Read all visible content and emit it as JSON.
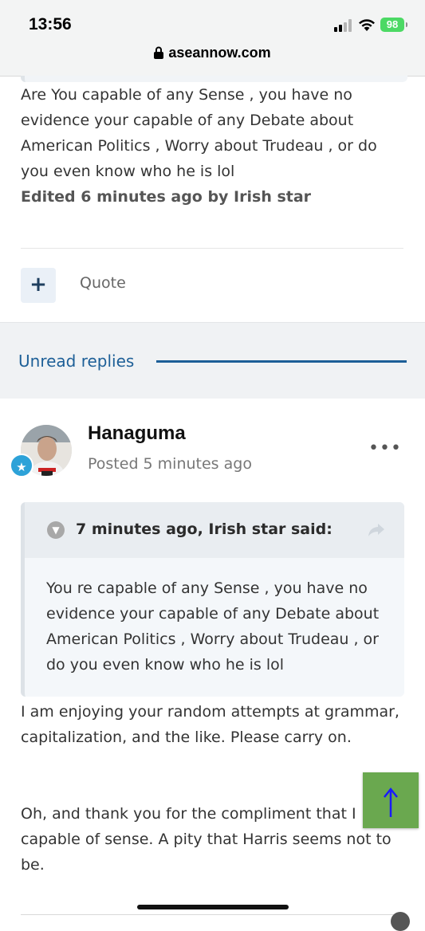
{
  "status_bar": {
    "time": "13:56",
    "battery": "98",
    "battery_color": "#4cd964",
    "icons": [
      "signal-icon",
      "wifi-icon",
      "battery-icon"
    ]
  },
  "browser": {
    "url": "aseannow.com",
    "lock_icon": "lock-icon"
  },
  "first_post": {
    "text": "Are You capable of any Sense , you have no evidence your capable of any Debate about American Politics , Worry about Trudeau , or do you even know who he is lol",
    "edited": "Edited 6 minutes ago by Irish star",
    "actions": {
      "plus": "+",
      "quote": "Quote"
    }
  },
  "unread_replies": {
    "label": "Unread replies",
    "accent": "#1d5f97"
  },
  "second_post": {
    "author": "Hanaguma",
    "posted": "Posted 5 minutes ago",
    "badge_icon": "star-icon",
    "quote": {
      "citation": "7 minutes ago, Irish star said:",
      "text": "You re  capable of any Sense , you have no evidence your capable of any Debate about American Politics , Worry about Trudeau , or do you even know who he is lol"
    },
    "reply_paragraph_1": "I am enjoying your random attempts at grammar, capitalization, and the like. Please carry on.",
    "reply_paragraph_2": "Oh, and thank you for the compliment that I capable of sense. A pity that Harris seems not to be."
  },
  "scroll_top": {
    "icon": "arrow-up-icon",
    "color": "#6aa84f"
  }
}
